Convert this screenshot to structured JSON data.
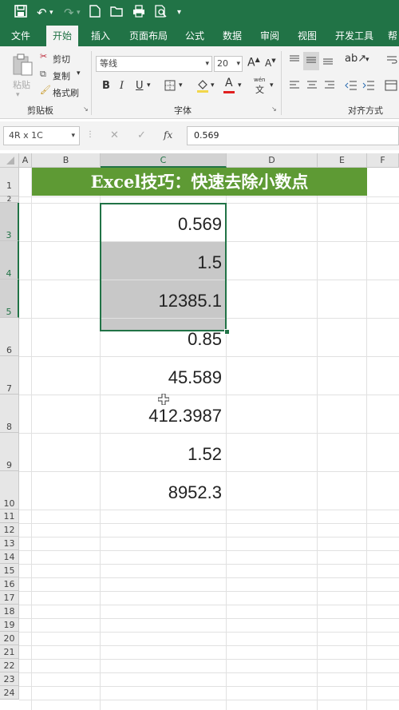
{
  "colors": {
    "accent": "#217346",
    "title_fill": "#5e9a34",
    "selection_gray": "#c8c8c8"
  },
  "qat_icons": [
    "save-icon",
    "undo-icon",
    "redo-icon",
    "new-file-icon",
    "open-icon",
    "print-icon",
    "print-preview-icon",
    "customize-qat-icon"
  ],
  "tabs": [
    "文件",
    "开始",
    "插入",
    "页面布局",
    "公式",
    "数据",
    "审阅",
    "视图",
    "开发工具",
    "帮"
  ],
  "active_tab": "开始",
  "ribbon": {
    "paste_label": "粘贴",
    "cut_label": "剪切",
    "copy_label": "复制",
    "format_painter_label": "格式刷",
    "clipboard_group": "剪贴板",
    "font_name": "等线",
    "font_size": "20",
    "font_group": "字体",
    "bold": "B",
    "italic": "I",
    "underline": "U",
    "grow_font": "A",
    "shrink_font": "A",
    "font_color_label": "A",
    "phonetic_label": "wén",
    "phonetic_char": "文",
    "align_group": "对齐方式"
  },
  "formula_bar": {
    "name_box": "4R x 1C",
    "cancel": "✕",
    "enter": "✓",
    "fx": "fx",
    "content": "0.569"
  },
  "sheet": {
    "columns": [
      "A",
      "B",
      "C",
      "D",
      "E",
      "F"
    ],
    "selected_column": "C",
    "title": "Excel技巧：快速去除小数点",
    "rows": [
      "1",
      "2",
      "3",
      "4",
      "5",
      "6",
      "7",
      "8",
      "9",
      "10",
      "11",
      "12",
      "13",
      "14",
      "15",
      "16",
      "17",
      "18",
      "19",
      "20",
      "21",
      "22",
      "23",
      "24"
    ],
    "values": [
      "0.569",
      "1.5",
      "12385.1",
      "0.85",
      "45.589",
      "412.3987",
      "1.52",
      "8952.3"
    ]
  }
}
